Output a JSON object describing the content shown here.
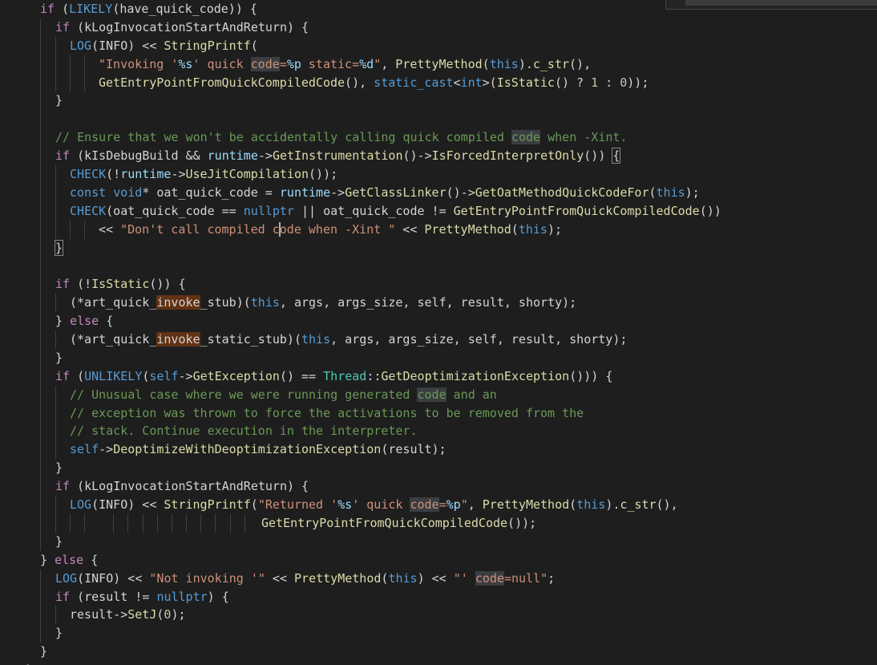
{
  "editor": {
    "language": "cpp",
    "theme": "dark",
    "lines": [
      "if (LIKELY(have_quick_code)) {",
      "if (kLogInvocationStartAndReturn) {",
      "LOG(INFO) << StringPrintf(",
      "\"Invoking '%s' quick code=%p static=%d\", PrettyMethod(this).c_str(),",
      "GetEntryPointFromQuickCompiledCode(), static_cast<int>(IsStatic() ? 1 : 0));",
      "}",
      "",
      "// Ensure that we won't be accidentally calling quick compiled code when -Xint.",
      "if (kIsDebugBuild && runtime->GetInstrumentation()->IsForcedInterpretOnly()) {",
      "CHECK(!runtime->UseJitCompilation());",
      "const void* oat_quick_code = runtime->GetClassLinker()->GetOatMethodQuickCodeFor(this);",
      "CHECK(oat_quick_code == nullptr || oat_quick_code != GetEntryPointFromQuickCompiledCode())",
      "<< \"Don't call compiled code when -Xint \" << PrettyMethod(this);",
      "}",
      "",
      "if (!IsStatic()) {",
      "(*art_quick_invoke_stub)(this, args, args_size, self, result, shorty);",
      "} else {",
      "(*art_quick_invoke_static_stub)(this, args, args_size, self, result, shorty);",
      "}",
      "if (UNLIKELY(self->GetException() == Thread::GetDeoptimizationException())) {",
      "// Unusual case where we were running generated code and an",
      "// exception was thrown to force the activations to be removed from the",
      "// stack. Continue execution in the interpreter.",
      "self->DeoptimizeWithDeoptimizationException(result);",
      "}",
      "if (kLogInvocationStartAndReturn) {",
      "LOG(INFO) << StringPrintf(\"Returned '%s' quick code=%p\", PrettyMethod(this).c_str(),",
      "GetEntryPointFromQuickCompiledCode());",
      "}",
      "} else {",
      "LOG(INFO) << \"Not invoking '\" << PrettyMethod(this) << \"' code=null\";",
      "if (result != nullptr) {",
      "result->SetJ(0);",
      "}",
      "}",
      "}"
    ],
    "colors": {
      "background": "#1e1e1e",
      "keyword": "#569cd6",
      "control": "#c586c0",
      "string": "#ce9178",
      "function": "#dcdcaa",
      "comment": "#6a9955",
      "type": "#4ec9b0",
      "variable": "#9cdcfe",
      "number": "#b5cea8",
      "highlight_word": "#3a3d41",
      "highlight_invoke": "#613214"
    }
  }
}
